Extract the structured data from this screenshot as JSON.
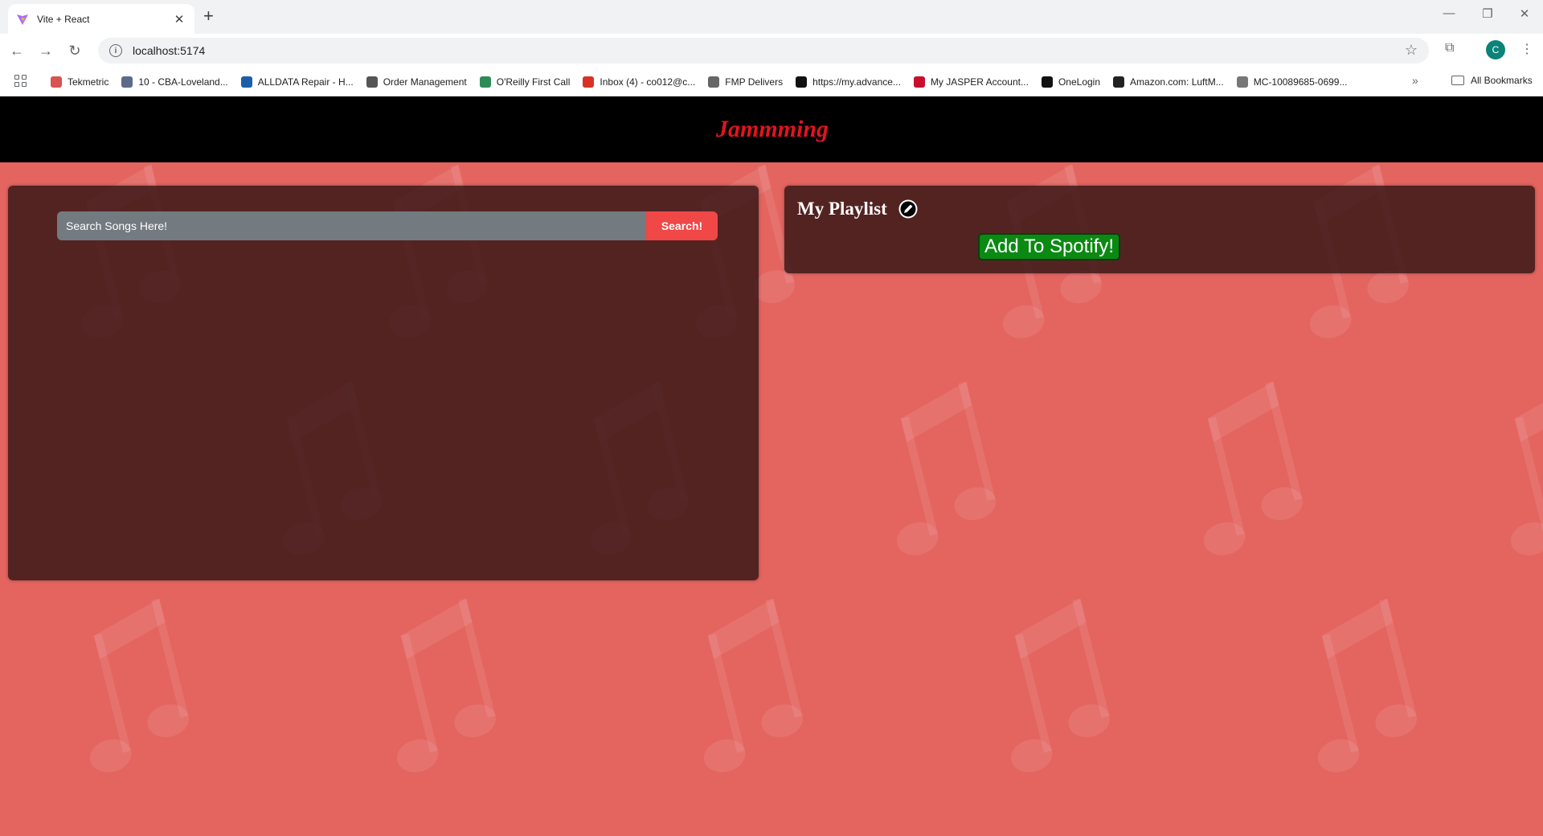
{
  "browser": {
    "tab_title": "Vite + React",
    "url": "localhost:5174",
    "profile_initial": "C",
    "bookmarks": [
      {
        "label": "Tekmetric",
        "icon": "tekmetric-icon",
        "color": "#d9534f"
      },
      {
        "label": "10 - CBA-Loveland...",
        "icon": "car-icon",
        "color": "#5b6b8a"
      },
      {
        "label": "ALLDATA Repair - H...",
        "icon": "alldata-icon",
        "color": "#1b5fa8"
      },
      {
        "label": "Order Management",
        "icon": "order-icon",
        "color": "#555555"
      },
      {
        "label": "O'Reilly First Call",
        "icon": "oreilly-icon",
        "color": "#2e8b57"
      },
      {
        "label": "Inbox (4) - co012@c...",
        "icon": "gmail-icon",
        "color": "#d93025"
      },
      {
        "label": "FMP Delivers",
        "icon": "fmp-icon",
        "color": "#666666"
      },
      {
        "label": "https://my.advance...",
        "icon": "advance-icon",
        "color": "#111111"
      },
      {
        "label": "My JASPER Account...",
        "icon": "jasper-icon",
        "color": "#c8102e"
      },
      {
        "label": "OneLogin",
        "icon": "onelogin-icon",
        "color": "#111111"
      },
      {
        "label": "Amazon.com: LuftM...",
        "icon": "amazon-icon",
        "color": "#222222"
      },
      {
        "label": "MC-10089685-0699...",
        "icon": "globe-icon",
        "color": "#777777"
      }
    ],
    "all_bookmarks_label": "All Bookmarks"
  },
  "app": {
    "title": "Jammming",
    "search": {
      "placeholder": "Search Songs Here!",
      "button_label": "Search!"
    },
    "playlist": {
      "name": "My Playlist",
      "save_button_label": "Add To Spotify!"
    }
  },
  "colors": {
    "background": "#e46560",
    "header": "#000000",
    "title": "#e0141f",
    "panel": "#3a1818",
    "search_button": "#f04747",
    "spotify_button": "#0a8a12"
  }
}
